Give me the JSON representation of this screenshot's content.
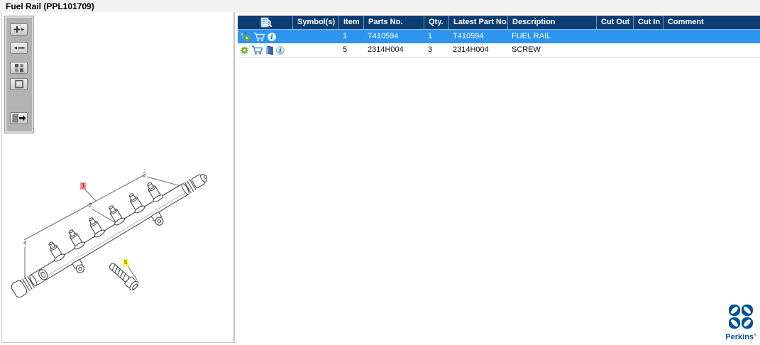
{
  "title": "Fuel Rail (PPL101709)",
  "colors": {
    "header_bg": "#0e3d74",
    "selected_row_bg": "#2e95ef",
    "highlight_red": "#f09090",
    "highlight_yellow": "#ffff2e",
    "perkins_blue": "#00529b"
  },
  "toolbar": {
    "buttons": [
      {
        "id": "zoom-in",
        "icon": "zoom-in-plus-icon"
      },
      {
        "id": "zoom-out",
        "icon": "zoom-out-minus-icon"
      },
      {
        "id": "tile-view",
        "icon": "tiles-icon"
      },
      {
        "id": "marquee-zoom",
        "icon": "square-outline-icon"
      },
      {
        "id": "toggle-parts-list",
        "icon": "list-arrow-icon"
      }
    ]
  },
  "diagram": {
    "callouts": [
      {
        "label": "1",
        "highlight": "red"
      },
      {
        "label": "2",
        "highlight": "none"
      },
      {
        "label": "3",
        "highlight": "none"
      },
      {
        "label": "4",
        "highlight": "none"
      },
      {
        "label": "5",
        "highlight": "yellow"
      }
    ]
  },
  "table": {
    "header_icon": "document-search-icon",
    "columns": [
      "",
      "Symbol(s)",
      "Item",
      "Parts No.",
      "Qty.",
      "Latest Part No.",
      "Description",
      "Cut Out",
      "Cut In",
      "Comment"
    ],
    "rows": [
      {
        "icons": [
          "gear-sparkle-icon",
          "cart-icon",
          "info-icon"
        ],
        "symbols": "",
        "item": "1",
        "parts_no": "T410594",
        "qty": "1",
        "latest_part_no": "T410594",
        "description": "FUEL RAIL",
        "cut_out": "",
        "cut_in": "",
        "comment": ""
      },
      {
        "icons": [
          "gear-icon",
          "cart-icon",
          "book-icon",
          "info-icon"
        ],
        "symbols": "",
        "item": "5",
        "parts_no": "2314H004",
        "qty": "3",
        "latest_part_no": "2314H004",
        "description": "SCREW",
        "cut_out": "",
        "cut_in": "",
        "comment": ""
      }
    ]
  },
  "icon_glyphs": {
    "info": "i"
  },
  "branding": {
    "name": "Perkins",
    "reg": "®"
  }
}
